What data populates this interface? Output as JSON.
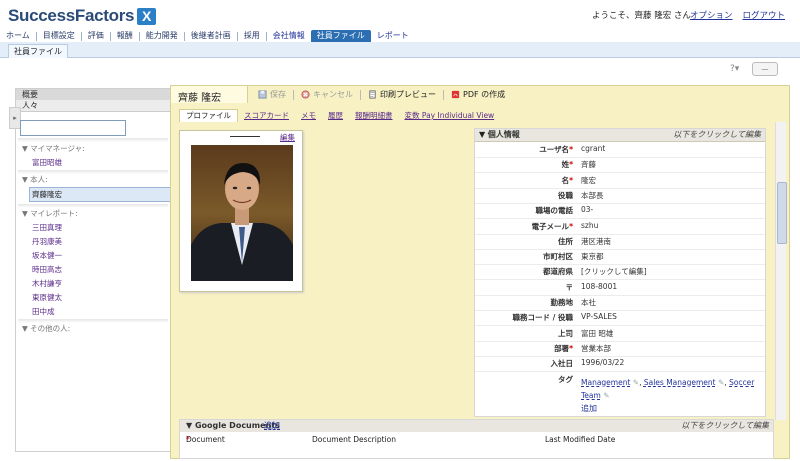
{
  "app": {
    "logo_text": "SuccessFactors",
    "logo_mark": "X"
  },
  "header": {
    "welcome": "ようこそ、齊藤 隆宏 さん",
    "links": [
      "オプション",
      "ログアウト"
    ]
  },
  "nav": {
    "items": [
      "ホーム",
      "目標設定",
      "評価",
      "報酬",
      "能力開発",
      "後継者計画",
      "採用",
      "会社情報",
      "社員ファイル",
      "レポート"
    ],
    "active": "社員ファイル"
  },
  "subnav": {
    "tab": "社員ファイル"
  },
  "help": {
    "icon": "?",
    "collapse": "—"
  },
  "sidebar": {
    "header": "概要",
    "people_label": "人々",
    "search_value": "",
    "sections": [
      {
        "label": "マイマネージャ:",
        "items": [
          "富田昭雄"
        ]
      },
      {
        "label": "本人:",
        "items": [
          "齊藤隆宏"
        ]
      },
      {
        "label": "マイレポート:",
        "items": [
          "三田真理",
          "丹羽康美",
          "坂本健一",
          "時田高志",
          "木村謙亨",
          "東原健太",
          "田中成"
        ]
      },
      {
        "label": "その他の人:",
        "items": []
      }
    ]
  },
  "profile": {
    "name": "齊藤 隆宏",
    "toolbar": [
      "保存",
      "キャンセル",
      "印刷プレビュー",
      "PDF の作成"
    ],
    "tabs": [
      "プロファイル",
      "スコアカード",
      "メモ",
      "履歴",
      "報酬明細書",
      "変数 Pay Individual View"
    ],
    "active_tab": "プロファイル",
    "photo_edit": "編集"
  },
  "info": {
    "title": "個人情報",
    "edit_hint": "以下をクリックして編集",
    "rows": [
      {
        "label": "ユーザ名",
        "required": true,
        "value": "cgrant"
      },
      {
        "label": "姓",
        "required": true,
        "value": "斉藤"
      },
      {
        "label": "名",
        "required": true,
        "value": "隆宏"
      },
      {
        "label": "役職",
        "required": false,
        "value": "本部長"
      },
      {
        "label": "職場の電話",
        "required": false,
        "value": "03-"
      },
      {
        "label": "電子メール",
        "required": true,
        "value": "szhu"
      },
      {
        "label": "住所",
        "required": false,
        "value": "港区港南"
      },
      {
        "label": "市町村区",
        "required": false,
        "value": "東京都"
      },
      {
        "label": "都道府県",
        "required": false,
        "value": "[クリックして編集]"
      },
      {
        "label": "〒",
        "required": false,
        "value": "108-8001"
      },
      {
        "label": "勤務地",
        "required": false,
        "value": "本社"
      },
      {
        "label": "職務コード / 役職",
        "required": false,
        "value": "VP-SALES"
      },
      {
        "label": "上司",
        "required": false,
        "value": "富田 昭雄"
      },
      {
        "label": "部署",
        "required": true,
        "value": "営業本部"
      },
      {
        "label": "入社日",
        "required": false,
        "value": "1996/03/22"
      }
    ],
    "tags_label": "タグ",
    "tags": [
      "Management",
      "Sales Management",
      "Soccer Team"
    ],
    "add_label": "追加"
  },
  "gdocs": {
    "title": "Google Documents",
    "add_label": "追加",
    "edit_hint": "以下をクリックして編集",
    "columns": [
      "Document",
      "Document Description",
      "Last Modified Date"
    ]
  },
  "colors": {
    "brand": "#2b4a78",
    "nav_active": "#2b6fb2",
    "panel_bg": "#f7f1c4",
    "link": "#22339a",
    "visited": "#5a2a8a"
  }
}
